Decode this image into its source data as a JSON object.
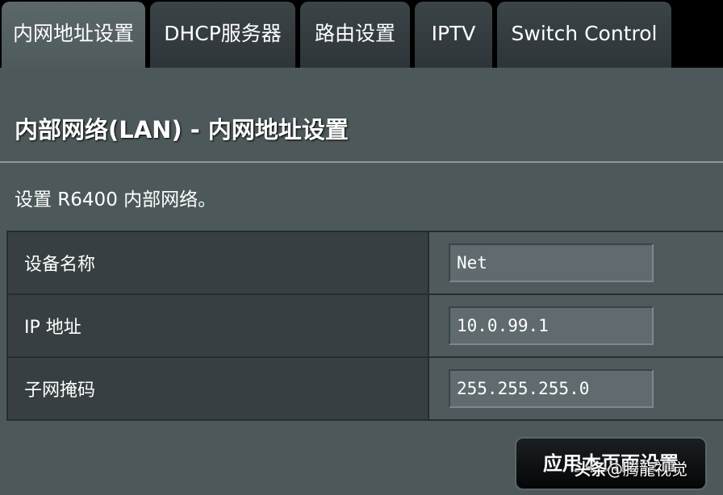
{
  "tabs": [
    {
      "label": "内网地址设置",
      "active": true
    },
    {
      "label": "DHCP服务器",
      "active": false
    },
    {
      "label": "路由设置",
      "active": false
    },
    {
      "label": "IPTV",
      "active": false
    },
    {
      "label": "Switch Control",
      "active": false
    }
  ],
  "section": {
    "title": "内部网络(LAN) - 内网地址设置",
    "description": "设置 R6400 内部网络。"
  },
  "settings": {
    "rows": [
      {
        "label": "设备名称",
        "value": "Net"
      },
      {
        "label": "IP 地址",
        "value": "10.0.99.1"
      },
      {
        "label": "子网掩码",
        "value": "255.255.255.0"
      }
    ]
  },
  "apply_button": {
    "label": "应用本页面设置"
  },
  "watermark": {
    "brand": "头条",
    "author": "@腾龍视觉"
  },
  "colors": {
    "panel_bg": "#4d585b",
    "label_cell_bg": "#383f42",
    "tab_active_bg": "#5b6769",
    "tab_inactive_bg": "#3b4447"
  }
}
